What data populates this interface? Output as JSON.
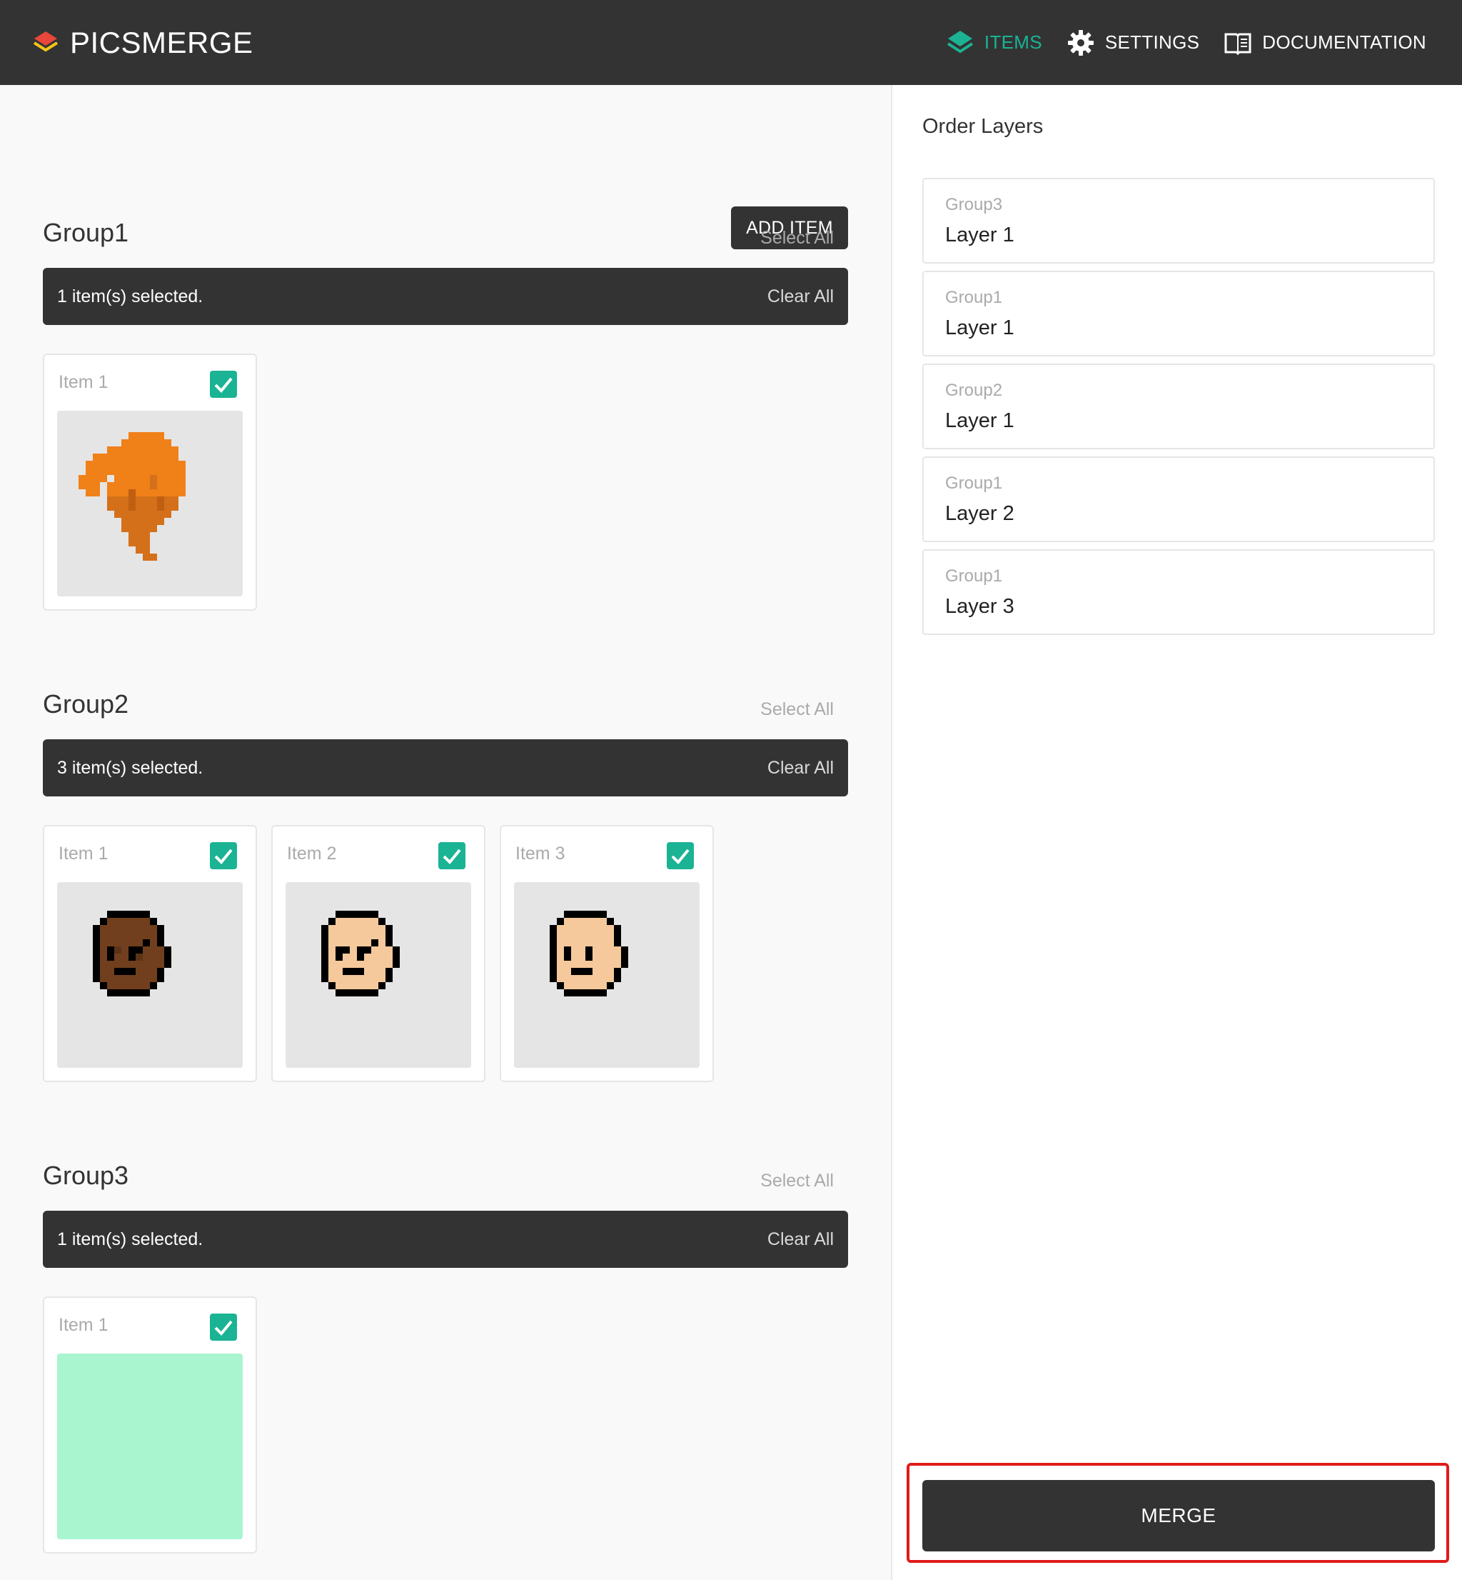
{
  "header": {
    "brand": "PICSMERGE",
    "nav": [
      {
        "label": "ITEMS",
        "icon": "layers-icon",
        "active": true
      },
      {
        "label": "SETTINGS",
        "icon": "gear-icon",
        "active": false
      },
      {
        "label": "DOCUMENTATION",
        "icon": "book-icon",
        "active": false
      }
    ]
  },
  "main": {
    "add_item_label": "ADD ITEM",
    "groups": [
      {
        "title": "Group1",
        "select_all": "Select All",
        "selected_text": "1 item(s) selected.",
        "clear_all": "Clear All",
        "items": [
          {
            "label": "Item 1",
            "checked": true,
            "image": "orange-hair"
          }
        ]
      },
      {
        "title": "Group2",
        "select_all": "Select All",
        "selected_text": "3 item(s) selected.",
        "clear_all": "Clear All",
        "items": [
          {
            "label": "Item 1",
            "checked": true,
            "image": "dark-face"
          },
          {
            "label": "Item 2",
            "checked": true,
            "image": "light-face-frown"
          },
          {
            "label": "Item 3",
            "checked": true,
            "image": "light-face-neutral"
          }
        ]
      },
      {
        "title": "Group3",
        "select_all": "Select All",
        "selected_text": "1 item(s) selected.",
        "clear_all": "Clear All",
        "items": [
          {
            "label": "Item 1",
            "checked": true,
            "image": "mint-background"
          }
        ]
      }
    ]
  },
  "side": {
    "title": "Order Layers",
    "layers": [
      {
        "group": "Group3",
        "layer": "Layer 1"
      },
      {
        "group": "Group1",
        "layer": "Layer 1"
      },
      {
        "group": "Group2",
        "layer": "Layer 1"
      },
      {
        "group": "Group1",
        "layer": "Layer 2"
      },
      {
        "group": "Group1",
        "layer": "Layer 3"
      }
    ],
    "merge_label": "MERGE"
  },
  "colors": {
    "header_bg": "#333333",
    "accent": "#1ab394",
    "check": "#1ab394",
    "highlight_border": "#e11a1a",
    "mint": "#a8f5cf",
    "hair_orange": "#f08018",
    "skin_dark": "#713f1d",
    "skin_light": "#f5c99b"
  }
}
